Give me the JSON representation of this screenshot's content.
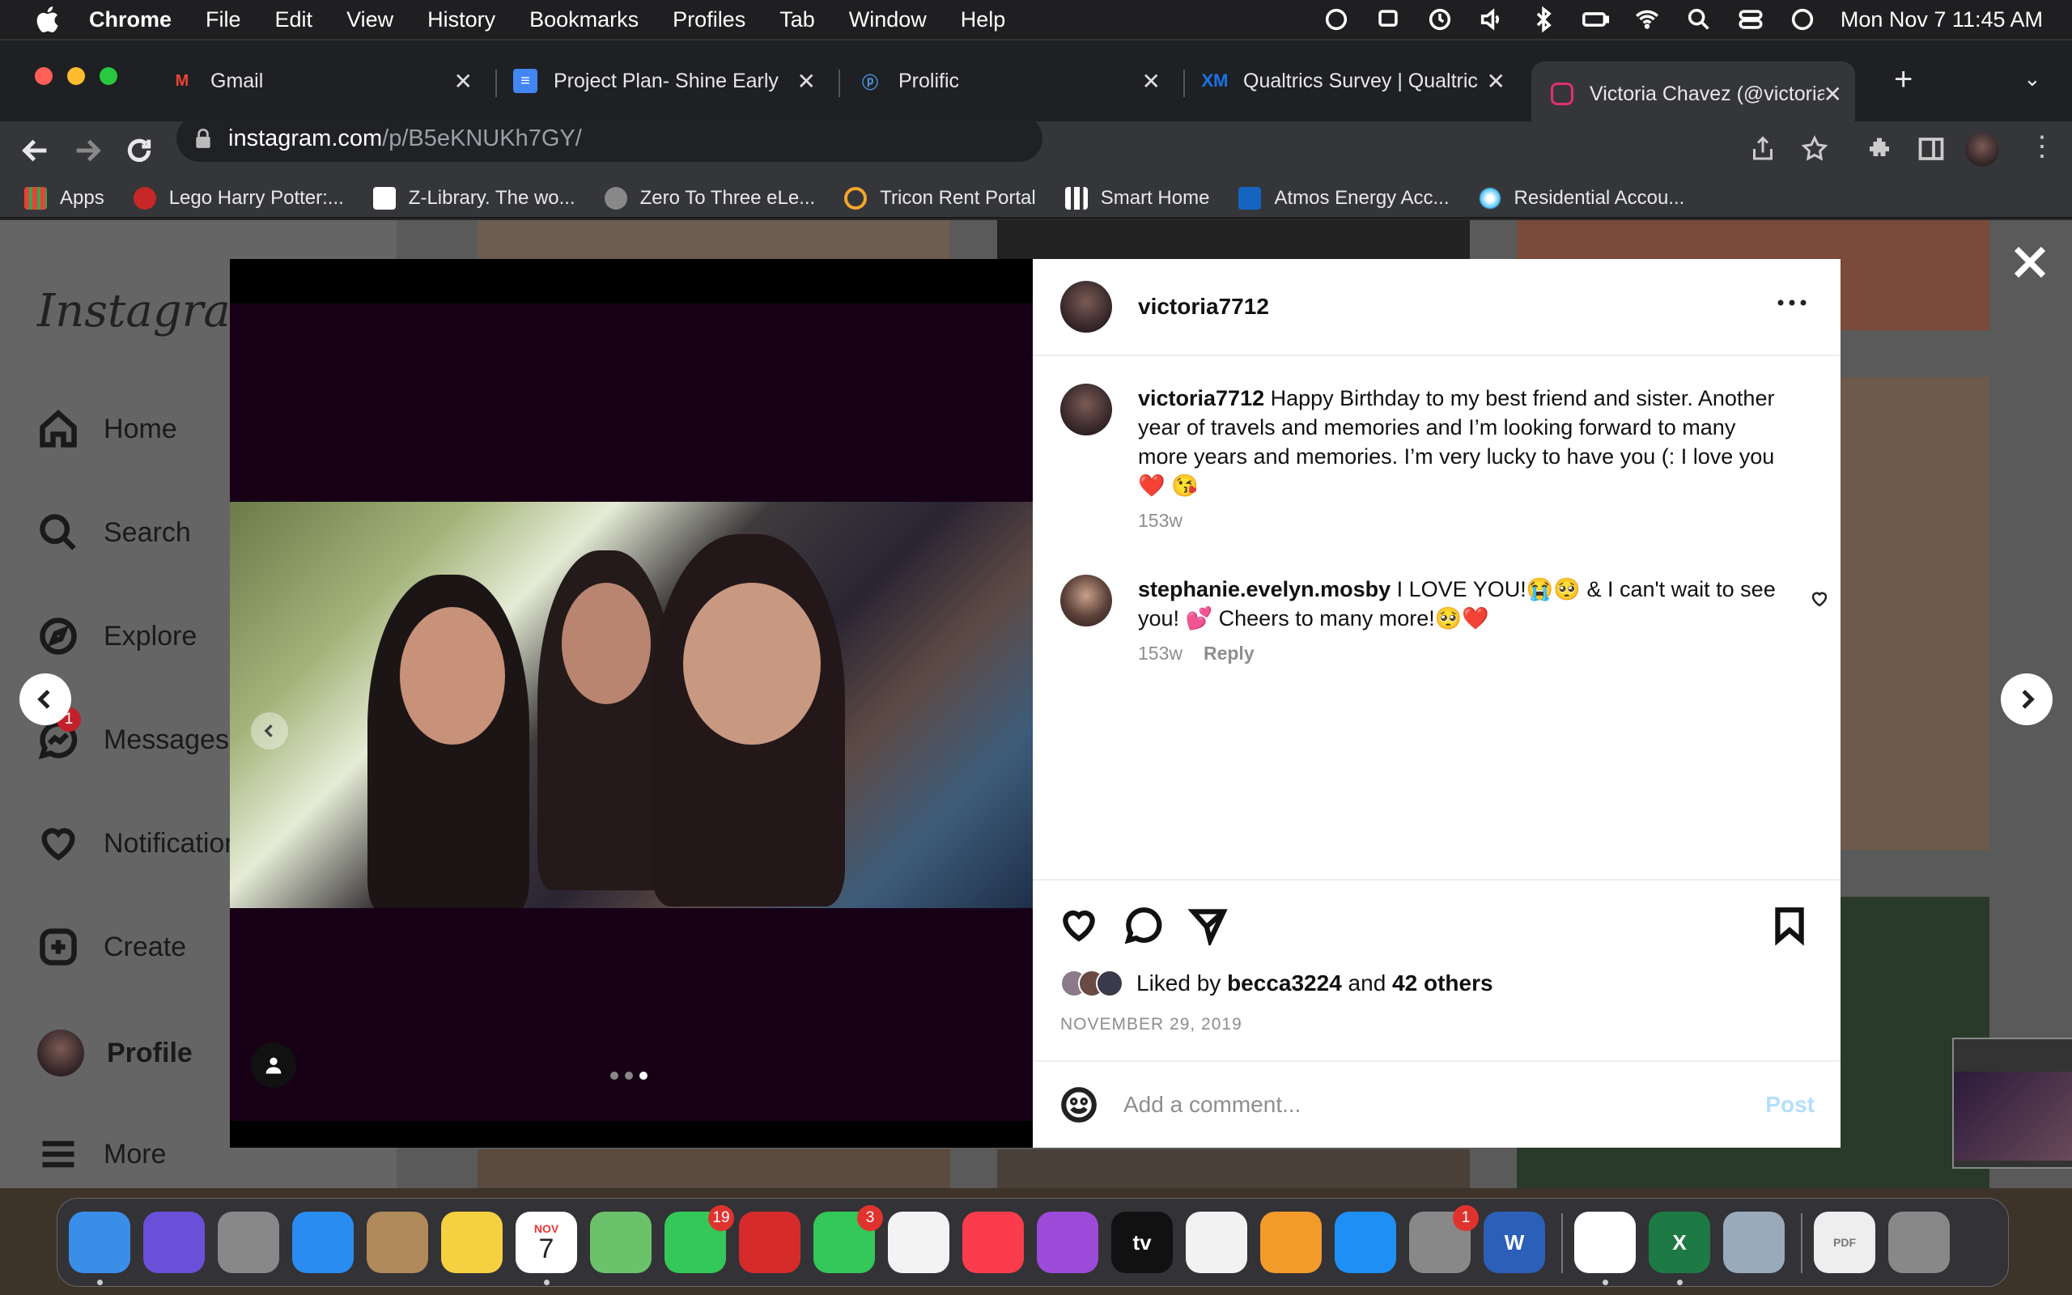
{
  "menubar": {
    "items": [
      "Chrome",
      "File",
      "Edit",
      "View",
      "History",
      "Bookmarks",
      "Profiles",
      "Tab",
      "Window",
      "Help"
    ],
    "datetime": "Mon Nov 7  11:45 AM"
  },
  "tabs": [
    {
      "title": "Gmail",
      "icon": "gmail-icon",
      "color": "#ea4335"
    },
    {
      "title": "Project Plan- Shine Early L",
      "icon": "docs-icon",
      "color": "#4285f4"
    },
    {
      "title": "Prolific",
      "icon": "prolific-icon",
      "color": "#4a90d9"
    },
    {
      "title": "Qualtrics Survey | Qualtric",
      "icon": "qualtrics-icon",
      "color": "#1a73e8"
    },
    {
      "title": "Victoria Chavez (@victoria",
      "icon": "instagram-icon",
      "color": "#e1306c"
    }
  ],
  "address": {
    "host": "instagram.com",
    "path": "/p/B5eKNUKh7GY/"
  },
  "bookmarks": [
    {
      "label": "Apps"
    },
    {
      "label": "Lego Harry Potter:..."
    },
    {
      "label": "Z-Library. The wo..."
    },
    {
      "label": "Zero To Three eLe..."
    },
    {
      "label": "Tricon Rent Portal"
    },
    {
      "label": "Smart Home"
    },
    {
      "label": "Atmos Energy Acc..."
    },
    {
      "label": "Residential Accou..."
    }
  ],
  "sidebar": {
    "logo": "Instagram",
    "items": [
      {
        "label": "Home"
      },
      {
        "label": "Search"
      },
      {
        "label": "Explore"
      },
      {
        "label": "Messages",
        "badge": "1"
      },
      {
        "label": "Notifications"
      },
      {
        "label": "Create"
      },
      {
        "label": "Profile"
      },
      {
        "label": "More"
      }
    ]
  },
  "post": {
    "username": "victoria7712",
    "caption_user": "victoria7712",
    "caption": "Happy Birthday to my best friend and sister. Another year of travels and memories and I’m looking forward to many more years and memories. I’m very lucky to have you (: I love you ❤️ 😘",
    "caption_age": "153w",
    "comments": [
      {
        "user": "stephanie.evelyn.mosby",
        "text": "I LOVE YOU!😭🥺 & I can't wait to see you! 💕 Cheers to many more!🥺❤️",
        "age": "153w",
        "reply": "Reply"
      }
    ],
    "likes_prefix": "Liked by",
    "likes_user": "becca3224",
    "likes_and": "and",
    "likes_others": "42 others",
    "date": "NOVEMBER 29, 2019",
    "add_comment_placeholder": "Add a comment...",
    "post_button": "Post",
    "carousel_count": 3,
    "carousel_active": 3
  },
  "dock": {
    "items": [
      {
        "name": "Finder",
        "color": "#3b8ee8"
      },
      {
        "name": "Siri",
        "color": "#6a4fd8"
      },
      {
        "name": "Launchpad",
        "color": "#888"
      },
      {
        "name": "Safari",
        "color": "#2a8cf0"
      },
      {
        "name": "Contacts",
        "color": "#b08a5a"
      },
      {
        "name": "Notes",
        "color": "#f5d142"
      },
      {
        "name": "Calendar",
        "color": "#fff",
        "month": "NOV",
        "day": "7"
      },
      {
        "name": "Maps",
        "color": "#6cc26a"
      },
      {
        "name": "Messages",
        "color": "#34c759",
        "badge": "19"
      },
      {
        "name": "Photo Booth",
        "color": "#d52b2b"
      },
      {
        "name": "FaceTime",
        "color": "#34c759",
        "badge": "3"
      },
      {
        "name": "Photos",
        "color": "#f3f3f3"
      },
      {
        "name": "Music",
        "color": "#fa3c4c"
      },
      {
        "name": "Podcasts",
        "color": "#9b4bd8"
      },
      {
        "name": "TV",
        "color": "#111",
        "label": "tv"
      },
      {
        "name": "News",
        "color": "#f2f2f2"
      },
      {
        "name": "Books",
        "color": "#f29b2b"
      },
      {
        "name": "App Store",
        "color": "#1e8ff5"
      },
      {
        "name": "System Preferences",
        "color": "#888",
        "badge": "1"
      },
      {
        "name": "Word",
        "color": "#2b5fb8",
        "label": "W"
      },
      {
        "name": "Chrome",
        "color": "#ffffff"
      },
      {
        "name": "Excel",
        "color": "#1d7a45",
        "label": "X"
      },
      {
        "name": "Preview",
        "color": "#9ab"
      },
      {
        "name": "Documents",
        "color": "#eee",
        "label": "PDF"
      },
      {
        "name": "Trash",
        "color": "#888"
      }
    ]
  }
}
